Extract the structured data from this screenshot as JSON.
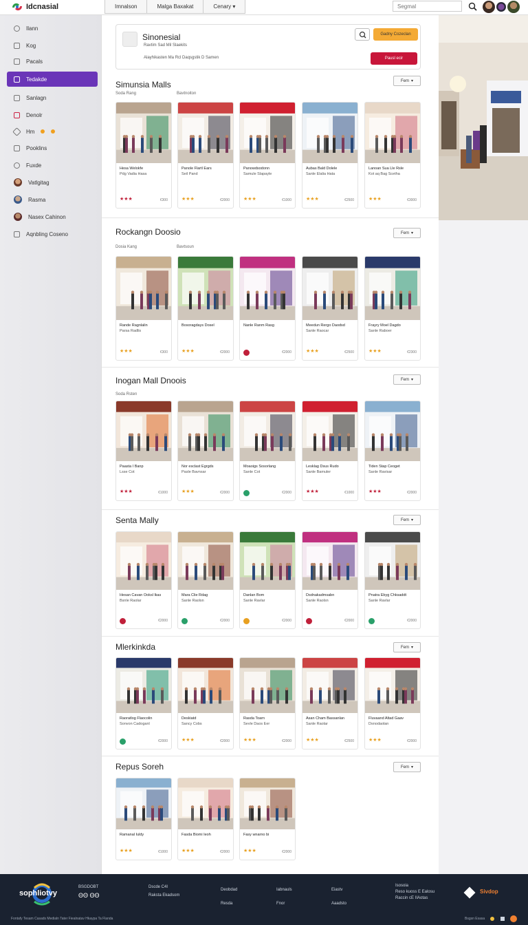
{
  "app": {
    "brand": "Idcnasial"
  },
  "top_tabs": [
    "Imnalson",
    "Malga Baxakat",
    "Cenary"
  ],
  "search": {
    "placeholder": "Segmal"
  },
  "sidebar": {
    "items": [
      {
        "label": "Ilann"
      },
      {
        "label": "Kog"
      },
      {
        "label": "Pacals"
      },
      {
        "label": "Tedakde"
      },
      {
        "label": "Sanlagn"
      },
      {
        "label": "Denolr"
      },
      {
        "label": "Hm"
      },
      {
        "label": "Pooklins"
      },
      {
        "label": "Fuxde"
      },
      {
        "label": "Vatlgitag"
      },
      {
        "label": "Rasma"
      },
      {
        "label": "Nasex Cahinon"
      },
      {
        "label": "Aqnbling Coseno"
      }
    ]
  },
  "header_card": {
    "title": "Sinonesial",
    "subtitle1": "Ravtim Sad Mil Slaekits",
    "subtitle2": "Alayhikasten Ma Rcl Daqsgstik D Samen",
    "yellow_button": "Gadny Cozeclan",
    "red_button": "Pausl ecir"
  },
  "sections": [
    {
      "title": "Simunsia Malls",
      "sub": [
        "Soda Rang",
        "Bavtnoiton"
      ],
      "filter": "Fem",
      "cards": [
        {
          "title": "Hesa Welokfe",
          "title2": "Pdg Vadia Hasa",
          "stars": "★★★",
          "price": "€300"
        },
        {
          "title": "Panole Flartl Ears",
          "title2": "Seil Pand",
          "stars": "★★★",
          "price": "€2000"
        },
        {
          "title": "Panowdsodonn",
          "title2": "Samule Slapayle",
          "stars": "★★★",
          "price": "€1000"
        },
        {
          "title": "Aubas Bald Dolele",
          "title2": "Sanle Elalia Hata",
          "stars": "★★★",
          "price": "€2500"
        },
        {
          "title": "Lanoan Sua Lle Rsle",
          "title2": "Kot aq Bag Scetha",
          "stars": "★★★",
          "price": "€3000"
        }
      ]
    },
    {
      "title": "Rockangn Doosio",
      "sub": [
        "Dosia Kang",
        "Bavtsoun"
      ],
      "filter": "Fem",
      "cards": [
        {
          "title": "Rande Ragnlalin",
          "title2": "Parsa Radlis",
          "stars": "★★★",
          "price": "€300"
        },
        {
          "title": "Bosoragdays Dosel",
          "title2": "",
          "stars": "★★★",
          "price": "€2000"
        },
        {
          "title": "Nanle Ranm Rasg",
          "title2": "",
          "stars": "",
          "price": "€2000"
        },
        {
          "title": "Meedun Rergo Daodsd",
          "title2": "Sanle Raocar",
          "stars": "★★★",
          "price": "€2500"
        },
        {
          "title": "Frayry Moel Dagdo",
          "title2": "Sanle Raboer",
          "stars": "★★★",
          "price": "€2300"
        }
      ]
    },
    {
      "title": "Inogan Mall Dnoois",
      "sub": [
        "Soda Rsten"
      ],
      "filter": "Fem",
      "cards": [
        {
          "title": "Paasta I Banp",
          "title2": "Lsse Cot",
          "stars": "★★★",
          "price": "€1000"
        },
        {
          "title": "Nor esclast Egrgds",
          "title2": "Pasle Bavnsar",
          "stars": "★★★",
          "price": "€2000"
        },
        {
          "title": "Moaoigs Sosorlang",
          "title2": "Sanle Cot",
          "stars": "",
          "price": "€2000"
        },
        {
          "title": "Lesklag Dsus Rudo",
          "title2": "Sanle Bamuler",
          "stars": "★★★",
          "price": "€1000"
        },
        {
          "title": "Tiden Stap Ceoget",
          "title2": "Sanle Ravisar",
          "stars": "★★★",
          "price": "€2000"
        }
      ]
    },
    {
      "title": "Senta Mally",
      "sub": [],
      "filter": "Fem",
      "cards": [
        {
          "title": "Hesan Cavan Ooksl lkas",
          "title2": "Bsnle Raolar",
          "stars": "",
          "price": "€2000"
        },
        {
          "title": "Mara Clie Rdag",
          "title2": "Sanle Raolsn",
          "stars": "",
          "price": "€2000"
        },
        {
          "title": "Danlan Bom",
          "title2": "Sanle Ravlar",
          "stars": "",
          "price": "€2000"
        },
        {
          "title": "Dsdnakadmsabn",
          "title2": "Sanle Raolsn",
          "stars": "",
          "price": "€2000"
        },
        {
          "title": "Pnatra Ebyg Chksaddt",
          "title2": "Sanle Ravlar",
          "stars": "",
          "price": "€2000"
        }
      ]
    },
    {
      "title": "Mlerkinkda",
      "sub": [],
      "filter": "Fem",
      "cards": [
        {
          "title": "Raoratlog Flaocolin",
          "title2": "Sonvon Cadoganl",
          "stars": "",
          "price": "€2000"
        },
        {
          "title": "Deskiatd",
          "title2": "Sancy Cobs",
          "stars": "★★★",
          "price": "€2000"
        },
        {
          "title": "Rasda Toarn",
          "title2": "Sevle Daos Eer",
          "stars": "★★★",
          "price": "€2000"
        },
        {
          "title": "Asan Cham Bassanlan",
          "title2": "Sanle Raolar",
          "stars": "★★★",
          "price": "€2500"
        },
        {
          "title": "Fluvaand Altad Gaav",
          "title2": "Dsnodaolan",
          "stars": "★★★",
          "price": "€2000"
        }
      ]
    },
    {
      "title": "Repus Soreh",
      "sub": [],
      "filter": "Fem",
      "cards": [
        {
          "title": "Ramanal Iuldy",
          "title2": "",
          "stars": "★★★",
          "price": "€1000"
        },
        {
          "title": "Fasda Biomi Ieoh",
          "title2": "",
          "stars": "★★★",
          "price": "€2000"
        },
        {
          "title": "Fasy wnarno bi",
          "title2": "",
          "stars": "★★★",
          "price": "€2000"
        }
      ]
    }
  ],
  "footer": {
    "logo_text": "sophliotvy",
    "col1": [
      "BSGDOBT",
      "ΘΘ ΘΘ"
    ],
    "col2": [
      "Dscde C4I",
      "Raksta Ekadsom"
    ],
    "col3": [
      "Deobdad",
      "Resda"
    ],
    "col4": [
      "Iabnauls",
      "Fnor"
    ],
    "col5": [
      "Eiastv",
      "Aaadsto"
    ],
    "col6": [
      "Isosoia",
      "Reso kuoss E Ealosu",
      "Raccin cE IIAotas"
    ],
    "partner": "Sivdop",
    "bottom": "Fontafy Tesam Casads Medialn Tater Fiealnatav Hkaypa Ta Flanda",
    "bottom_right": "Bsgsn Esasa"
  }
}
